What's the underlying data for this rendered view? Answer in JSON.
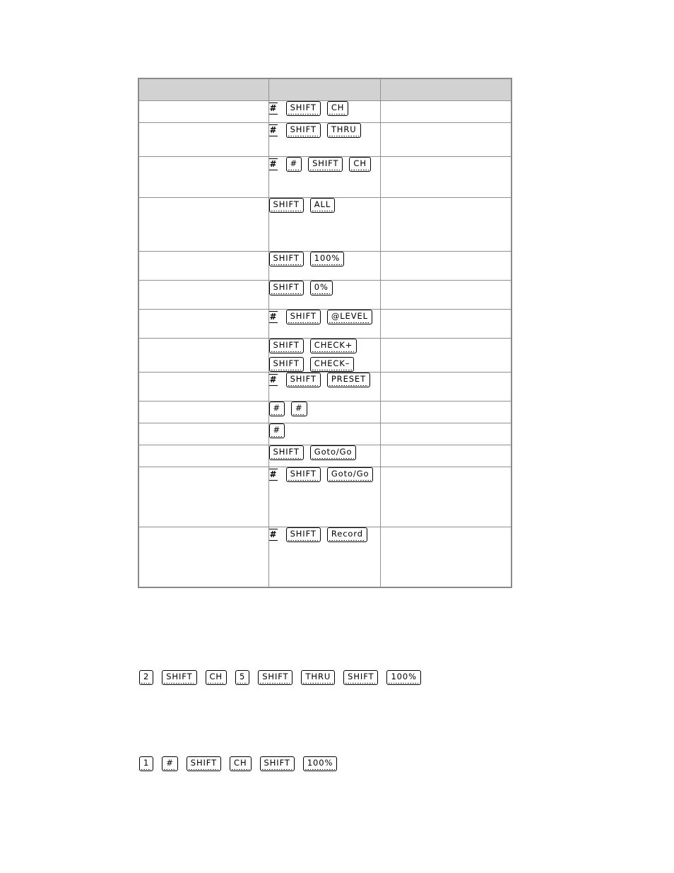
{
  "table": {
    "columns": [
      "",
      "",
      ""
    ],
    "rows": [
      {
        "left": "",
        "right": "",
        "sequences": [
          [
            {
              "type": "hash"
            },
            {
              "type": "key",
              "label": "SHIFT"
            },
            {
              "type": "key",
              "label": "CH"
            }
          ]
        ]
      },
      {
        "left": "",
        "right": "",
        "sequences": [
          [
            {
              "type": "hash"
            },
            {
              "type": "key",
              "label": "SHIFT"
            },
            {
              "type": "key",
              "label": "THRU"
            }
          ]
        ]
      },
      {
        "left": "",
        "right": "",
        "sequences": [
          [
            {
              "type": "hash"
            },
            {
              "type": "key",
              "label": "#"
            },
            {
              "type": "key",
              "label": "SHIFT"
            },
            {
              "type": "key",
              "label": "CH"
            }
          ]
        ]
      },
      {
        "left": "",
        "right": "",
        "sequences": [
          [
            {
              "type": "key",
              "label": "SHIFT"
            },
            {
              "type": "key",
              "label": "ALL"
            }
          ]
        ]
      },
      {
        "left": "",
        "right": "",
        "sequences": [
          [
            {
              "type": "key",
              "label": "SHIFT"
            },
            {
              "type": "key",
              "label": "100%"
            }
          ]
        ]
      },
      {
        "left": "",
        "right": "",
        "sequences": [
          [
            {
              "type": "key",
              "label": "SHIFT"
            },
            {
              "type": "key",
              "label": "0%"
            }
          ]
        ]
      },
      {
        "left": "",
        "right": "",
        "sequences": [
          [
            {
              "type": "hash"
            },
            {
              "type": "key",
              "label": "SHIFT"
            },
            {
              "type": "key",
              "label": "@LEVEL"
            }
          ]
        ]
      },
      {
        "left": "",
        "right": "",
        "sequences": [
          [
            {
              "type": "key",
              "label": "SHIFT"
            },
            {
              "type": "key",
              "label": "CHECK+"
            }
          ],
          [
            {
              "type": "key",
              "label": "SHIFT"
            },
            {
              "type": "key",
              "label": "CHECK–"
            }
          ]
        ]
      },
      {
        "left": "",
        "right": "",
        "sequences": [
          [
            {
              "type": "hash"
            },
            {
              "type": "key",
              "label": "SHIFT"
            },
            {
              "type": "key",
              "label": "PRESET"
            }
          ]
        ]
      },
      {
        "left": "",
        "right": "",
        "sequences": [
          [
            {
              "type": "key",
              "label": "#"
            },
            {
              "type": "key",
              "label": "#"
            }
          ]
        ]
      },
      {
        "left": "",
        "right": "",
        "sequences": [
          [
            {
              "type": "key",
              "label": "#"
            }
          ]
        ]
      },
      {
        "left": "",
        "right": "",
        "sequences": [
          [
            {
              "type": "key",
              "label": "SHIFT"
            },
            {
              "type": "key",
              "label": "Goto/Go"
            }
          ]
        ]
      },
      {
        "left": "",
        "right": "",
        "sequences": [
          [
            {
              "type": "hash"
            },
            {
              "type": "key",
              "label": "SHIFT"
            },
            {
              "type": "key",
              "label": "Goto/Go"
            }
          ]
        ]
      },
      {
        "left": "",
        "right": "",
        "sequences": [
          [
            {
              "type": "hash"
            },
            {
              "type": "key",
              "label": "SHIFT"
            },
            {
              "type": "key",
              "label": "Record"
            }
          ]
        ]
      }
    ]
  },
  "examples": [
    {
      "id": "example-1",
      "keys": [
        "2",
        "SHIFT",
        "CH",
        "5",
        "SHIFT",
        "THRU",
        "SHIFT",
        "100%"
      ]
    },
    {
      "id": "example-2",
      "keys": [
        "1",
        "#",
        "SHIFT",
        "CH",
        "SHIFT",
        "100%"
      ]
    }
  ]
}
